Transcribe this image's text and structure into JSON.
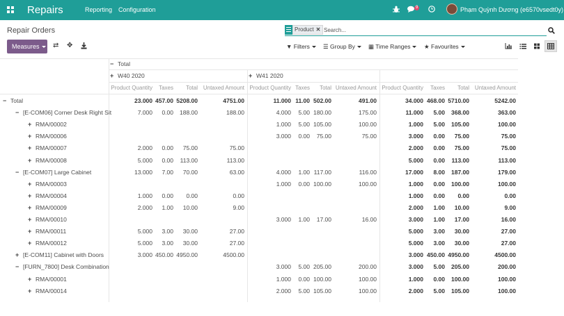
{
  "navbar": {
    "brand": "Repairs",
    "menu": [
      "Reporting",
      "Configuration"
    ],
    "chat_badge": "9",
    "user": "Phạm Quỳnh Dương (e6570vsedt0y)"
  },
  "control": {
    "title": "Repair Orders",
    "facet": "Product",
    "search_placeholder": "Search...",
    "measures": "Measures",
    "filters": "Filters",
    "group_by": "Group By",
    "time_ranges": "Time Ranges",
    "favourites": "Favourites"
  },
  "pivot": {
    "total_header": "Total",
    "col_groups": [
      "W40 2020",
      "W41 2020"
    ],
    "measures": [
      "Product Quantity",
      "Taxes",
      "Total",
      "Untaxed Amount"
    ],
    "rows": [
      {
        "label": "Total",
        "level": 0,
        "toggle": "minus",
        "bold": true,
        "g1": [
          "23.000",
          "457.00",
          "5208.00",
          "4751.00"
        ],
        "g2": [
          "11.000",
          "11.00",
          "502.00",
          "491.00"
        ],
        "t": [
          "34.000",
          "468.00",
          "5710.00",
          "5242.00"
        ]
      },
      {
        "label": "[E-COM06] Corner Desk Right Sit",
        "level": 1,
        "toggle": "minus",
        "g1": [
          "7.000",
          "0.00",
          "188.00",
          "188.00"
        ],
        "g2": [
          "4.000",
          "5.00",
          "180.00",
          "175.00"
        ],
        "t": [
          "11.000",
          "5.00",
          "368.00",
          "363.00"
        ]
      },
      {
        "label": "RMA/00002",
        "level": 2,
        "toggle": "plus",
        "g1": [
          "",
          "",
          "",
          ""
        ],
        "g2": [
          "1.000",
          "5.00",
          "105.00",
          "100.00"
        ],
        "t": [
          "1.000",
          "5.00",
          "105.00",
          "100.00"
        ]
      },
      {
        "label": "RMA/00006",
        "level": 2,
        "toggle": "plus",
        "g1": [
          "",
          "",
          "",
          ""
        ],
        "g2": [
          "3.000",
          "0.00",
          "75.00",
          "75.00"
        ],
        "t": [
          "3.000",
          "0.00",
          "75.00",
          "75.00"
        ]
      },
      {
        "label": "RMA/00007",
        "level": 2,
        "toggle": "plus",
        "g1": [
          "2.000",
          "0.00",
          "75.00",
          "75.00"
        ],
        "g2": [
          "",
          "",
          "",
          ""
        ],
        "t": [
          "2.000",
          "0.00",
          "75.00",
          "75.00"
        ]
      },
      {
        "label": "RMA/00008",
        "level": 2,
        "toggle": "plus",
        "g1": [
          "5.000",
          "0.00",
          "113.00",
          "113.00"
        ],
        "g2": [
          "",
          "",
          "",
          ""
        ],
        "t": [
          "5.000",
          "0.00",
          "113.00",
          "113.00"
        ]
      },
      {
        "label": "[E-COM07] Large Cabinet",
        "level": 1,
        "toggle": "minus",
        "g1": [
          "13.000",
          "7.00",
          "70.00",
          "63.00"
        ],
        "g2": [
          "4.000",
          "1.00",
          "117.00",
          "116.00"
        ],
        "t": [
          "17.000",
          "8.00",
          "187.00",
          "179.00"
        ]
      },
      {
        "label": "RMA/00003",
        "level": 2,
        "toggle": "plus",
        "g1": [
          "",
          "",
          "",
          ""
        ],
        "g2": [
          "1.000",
          "0.00",
          "100.00",
          "100.00"
        ],
        "t": [
          "1.000",
          "0.00",
          "100.00",
          "100.00"
        ]
      },
      {
        "label": "RMA/00004",
        "level": 2,
        "toggle": "plus",
        "g1": [
          "1.000",
          "0.00",
          "0.00",
          "0.00"
        ],
        "g2": [
          "",
          "",
          "",
          ""
        ],
        "t": [
          "1.000",
          "0.00",
          "0.00",
          "0.00"
        ]
      },
      {
        "label": "RMA/00009",
        "level": 2,
        "toggle": "plus",
        "g1": [
          "2.000",
          "1.00",
          "10.00",
          "9.00"
        ],
        "g2": [
          "",
          "",
          "",
          ""
        ],
        "t": [
          "2.000",
          "1.00",
          "10.00",
          "9.00"
        ]
      },
      {
        "label": "RMA/00010",
        "level": 2,
        "toggle": "plus",
        "g1": [
          "",
          "",
          "",
          ""
        ],
        "g2": [
          "3.000",
          "1.00",
          "17.00",
          "16.00"
        ],
        "t": [
          "3.000",
          "1.00",
          "17.00",
          "16.00"
        ]
      },
      {
        "label": "RMA/00011",
        "level": 2,
        "toggle": "plus",
        "g1": [
          "5.000",
          "3.00",
          "30.00",
          "27.00"
        ],
        "g2": [
          "",
          "",
          "",
          ""
        ],
        "t": [
          "5.000",
          "3.00",
          "30.00",
          "27.00"
        ]
      },
      {
        "label": "RMA/00012",
        "level": 2,
        "toggle": "plus",
        "g1": [
          "5.000",
          "3.00",
          "30.00",
          "27.00"
        ],
        "g2": [
          "",
          "",
          "",
          ""
        ],
        "t": [
          "5.000",
          "3.00",
          "30.00",
          "27.00"
        ]
      },
      {
        "label": "[E-COM11] Cabinet with Doors",
        "level": 1,
        "toggle": "plus",
        "g1": [
          "3.000",
          "450.00",
          "4950.00",
          "4500.00"
        ],
        "g2": [
          "",
          "",
          "",
          ""
        ],
        "t": [
          "3.000",
          "450.00",
          "4950.00",
          "4500.00"
        ]
      },
      {
        "label": "[FURN_7800] Desk Combination",
        "level": 1,
        "toggle": "minus",
        "g1": [
          "",
          "",
          "",
          ""
        ],
        "g2": [
          "3.000",
          "5.00",
          "205.00",
          "200.00"
        ],
        "t": [
          "3.000",
          "5.00",
          "205.00",
          "200.00"
        ]
      },
      {
        "label": "RMA/00001",
        "level": 2,
        "toggle": "plus",
        "g1": [
          "",
          "",
          "",
          ""
        ],
        "g2": [
          "1.000",
          "0.00",
          "100.00",
          "100.00"
        ],
        "t": [
          "1.000",
          "0.00",
          "100.00",
          "100.00"
        ]
      },
      {
        "label": "RMA/00014",
        "level": 2,
        "toggle": "plus",
        "g1": [
          "",
          "",
          "",
          ""
        ],
        "g2": [
          "2.000",
          "5.00",
          "105.00",
          "100.00"
        ],
        "t": [
          "2.000",
          "5.00",
          "105.00",
          "100.00"
        ]
      }
    ]
  }
}
